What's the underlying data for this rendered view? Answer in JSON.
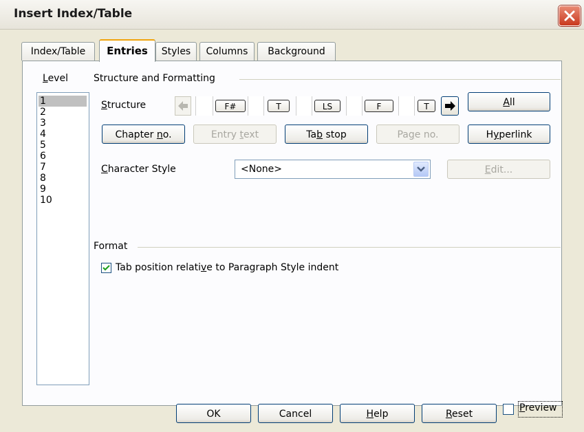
{
  "window": {
    "title": "Insert Index/Table"
  },
  "tabs": [
    {
      "label": "Index/Table"
    },
    {
      "label": "Entries"
    },
    {
      "label": "Styles"
    },
    {
      "label": "Columns"
    },
    {
      "label": "Background"
    }
  ],
  "level": {
    "label": "Level",
    "items": [
      "1",
      "2",
      "3",
      "4",
      "5",
      "6",
      "7",
      "8",
      "9",
      "10"
    ],
    "selected": "1"
  },
  "structure": {
    "group_label": "Structure and Formatting",
    "label": "Structure",
    "tokens": [
      "F#",
      "T",
      "LS",
      "F",
      "T"
    ],
    "all_button": "All"
  },
  "insert_buttons": {
    "chapter_no": "Chapter no.",
    "entry_text": "Entry text",
    "tab_stop": "Tab stop",
    "page_no": "Page no.",
    "hyperlink": "Hyperlink"
  },
  "character_style": {
    "label": "Character Style",
    "value": "<None>",
    "edit_button": "Edit..."
  },
  "format": {
    "group_label": "Format",
    "checkbox_label": "Tab position relative to Paragraph Style indent",
    "checked": true
  },
  "footer": {
    "ok": "OK",
    "cancel": "Cancel",
    "help": "Help",
    "reset": "Reset",
    "preview": "Preview",
    "preview_checked": false
  },
  "colors": {
    "accent_tab": "#f0a30a",
    "close_red": "#c9381e",
    "check_green": "#21a121"
  }
}
